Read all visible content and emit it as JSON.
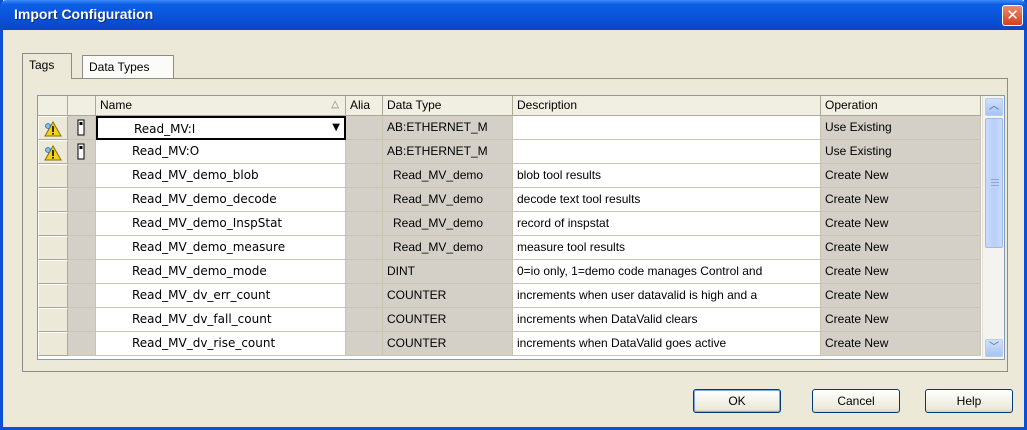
{
  "window": {
    "title": "Import Configuration",
    "close_glyph": "✕"
  },
  "tabs": [
    {
      "label": "Tags",
      "active": true
    },
    {
      "label": "Data Types",
      "active": false
    }
  ],
  "grid": {
    "columns": {
      "name": "Name",
      "alias": "Alia",
      "data_type": "Data Type",
      "description": "Description",
      "operation": "Operation"
    },
    "sort_indicator": "△",
    "rows": [
      {
        "status_icon": "warning-icon",
        "conn_icon": "plug-icon",
        "name": "Read_MV:I",
        "data_type": "AB:ETHERNET_M",
        "description": "",
        "operation": "Use Existing",
        "selected": true
      },
      {
        "status_icon": "warning-icon",
        "conn_icon": "plug-icon",
        "name": "Read_MV:O",
        "data_type": "AB:ETHERNET_M",
        "description": "",
        "operation": "Use Existing"
      },
      {
        "name": "Read_MV_demo_blob",
        "data_type": "Read_MV_demo",
        "description": "blob tool results",
        "operation": "Create New"
      },
      {
        "name": "Read_MV_demo_decode",
        "data_type": "Read_MV_demo",
        "description": "decode text tool results",
        "operation": "Create New"
      },
      {
        "name": "Read_MV_demo_InspStat",
        "data_type": "Read_MV_demo",
        "description": "record of inspstat",
        "operation": "Create New"
      },
      {
        "name": "Read_MV_demo_measure",
        "data_type": "Read_MV_demo",
        "description": "measure tool results",
        "operation": "Create New"
      },
      {
        "name": "Read_MV_demo_mode",
        "data_type": "DINT",
        "description": "0=io only, 1=demo code manages Control and",
        "operation": "Create New"
      },
      {
        "name": "Read_MV_dv_err_count",
        "data_type": "COUNTER",
        "description": "increments when user datavalid is high and a",
        "operation": "Create New"
      },
      {
        "name": "Read_MV_dv_fall_count",
        "data_type": "COUNTER",
        "description": "increments when DataValid clears",
        "operation": "Create New"
      },
      {
        "name": "Read_MV_dv_rise_count",
        "data_type": "COUNTER",
        "description": "increments when DataValid goes active",
        "operation": "Create New"
      }
    ]
  },
  "scrollbar": {
    "up_glyph": "︿",
    "down_glyph": "﹀"
  },
  "buttons": {
    "ok": "OK",
    "cancel": "Cancel",
    "help": "Help"
  },
  "colors": {
    "titlebar": "#0a52d8",
    "close": "#d1411f",
    "warning": "#f2d21b"
  }
}
